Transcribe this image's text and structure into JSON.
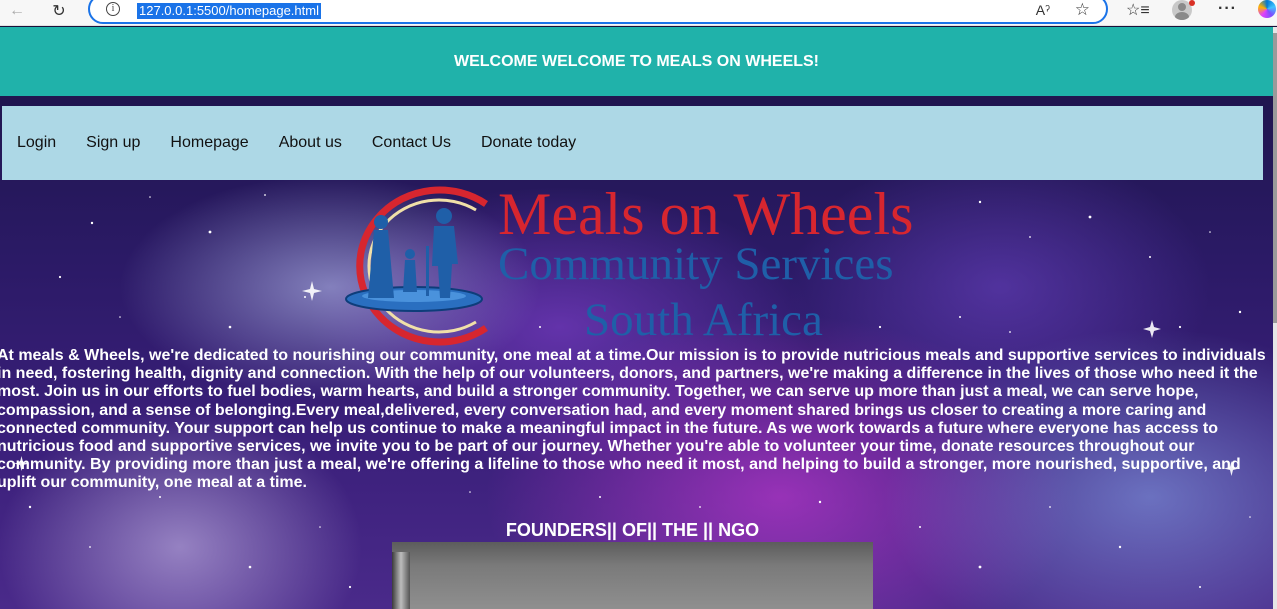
{
  "browser": {
    "url": "127.0.0.1:5500/homepage.html"
  },
  "header": {
    "title": "WELCOME WELCOME TO MEALS ON WHEELS!"
  },
  "nav": {
    "items": [
      {
        "label": "Login"
      },
      {
        "label": "Sign up"
      },
      {
        "label": "Homepage"
      },
      {
        "label": "About us"
      },
      {
        "label": "Contact Us"
      },
      {
        "label": "Donate today"
      }
    ]
  },
  "logo": {
    "line1": "Meals on Wheels",
    "line2": "Community Services",
    "line3": "South Africa"
  },
  "mission": {
    "text": "At meals & Wheels, we're dedicated to nourishing our community, one meal at a time.Our mission is to provide nutricious meals and supportive services to individuals in need, fostering health, dignity and connection. With the help of our volunteers, donors, and partners, we're making a difference in the lives of those who need it the most. Join us in our efforts to fuel bodies, warm hearts, and build a stronger community. Together, we can serve up more than just a meal, we can serve hope, compassion, and a sense of belonging.Every meal,delivered, every conversation had, and every moment shared brings us closer to creating a more caring and connected community. Your support can help us continue to make a meaningful impact in the future. As we work towards a future where everyone has access to nutricious food and supportive services, we invite you to be part of our journey. Whether you're able to volunteer your time, donate resources throughout our community. By providing more than just a meal, we're offering a lifeline to those who need it most, and helping to build a stronger, more nourished, supportive, and uplift our community, one meal at a time."
  },
  "founders": {
    "title": "FOUNDERS|| OF|| THE || NGO"
  },
  "colors": {
    "header_bg": "#20b2aa",
    "nav_bg": "#add8e6",
    "logo_red": "#d7262f",
    "logo_blue": "#1f5fa8"
  }
}
